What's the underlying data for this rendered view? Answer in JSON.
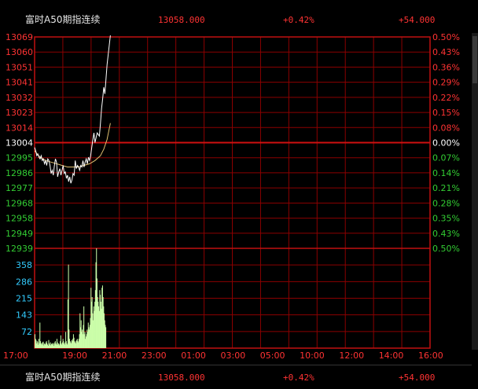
{
  "header": {
    "title": "富时A50期指连续",
    "price": "13058.000",
    "change_pct": "+0.42%",
    "change": "+54.000"
  },
  "footer": {
    "title": "富时A50期指连续",
    "price": "13058.000",
    "change_pct": "+0.42%",
    "change": "+54.000"
  },
  "colors": {
    "background": "#000000",
    "grid": "#8b0000",
    "up": "#ff3333",
    "down": "#33cc33",
    "neutral": "#ffffff",
    "price_line": "#ffffff",
    "avg_line": "#e0c070",
    "volume_axis": "#33ccff",
    "volume_bars": "#ccffaa",
    "time_axis": "#ff3333"
  },
  "chart_data": [
    {
      "type": "line",
      "name": "price",
      "ylim": [
        12939,
        13069
      ],
      "reference": 13004,
      "y_ticks": [
        {
          "label": "13069",
          "pct": "0.50%",
          "dir": "up"
        },
        {
          "label": "13060",
          "pct": "0.43%",
          "dir": "up"
        },
        {
          "label": "13051",
          "pct": "0.36%",
          "dir": "up"
        },
        {
          "label": "13041",
          "pct": "0.29%",
          "dir": "up"
        },
        {
          "label": "13032",
          "pct": "0.22%",
          "dir": "up"
        },
        {
          "label": "13023",
          "pct": "0.15%",
          "dir": "up"
        },
        {
          "label": "13014",
          "pct": "0.08%",
          "dir": "up"
        },
        {
          "label": "13004",
          "pct": "0.00%",
          "dir": "flat"
        },
        {
          "label": "12995",
          "pct": "0.07%",
          "dir": "down"
        },
        {
          "label": "12986",
          "pct": "0.14%",
          "dir": "down"
        },
        {
          "label": "12977",
          "pct": "0.21%",
          "dir": "down"
        },
        {
          "label": "12968",
          "pct": "0.28%",
          "dir": "down"
        },
        {
          "label": "12958",
          "pct": "0.35%",
          "dir": "down"
        },
        {
          "label": "12949",
          "pct": "0.43%",
          "dir": "down"
        },
        {
          "label": "12939",
          "pct": "0.50%",
          "dir": "down"
        }
      ],
      "x_ticks": [
        "17:00",
        "19:00",
        "21:00",
        "23:00",
        "01:00",
        "03:00",
        "05:00",
        "10:00",
        "12:00",
        "14:00",
        "16:00"
      ],
      "session_minutes": 1440,
      "series": [
        {
          "values": [
            [
              0,
              13001
            ],
            [
              4,
              12999
            ],
            [
              8,
              12996
            ],
            [
              12,
              12997
            ],
            [
              16,
              12995
            ],
            [
              20,
              12994
            ],
            [
              24,
              12996
            ],
            [
              28,
              12993
            ],
            [
              32,
              12994
            ],
            [
              36,
              12991
            ],
            [
              40,
              12993
            ],
            [
              44,
              12990
            ],
            [
              48,
              12994
            ],
            [
              52,
              12993
            ],
            [
              56,
              12990
            ],
            [
              60,
              12985
            ],
            [
              64,
              12987
            ],
            [
              68,
              12984
            ],
            [
              72,
              12990
            ],
            [
              76,
              12994
            ],
            [
              80,
              12992
            ],
            [
              84,
              12983
            ],
            [
              88,
              12986
            ],
            [
              92,
              12988
            ],
            [
              96,
              12984
            ],
            [
              100,
              12987
            ],
            [
              104,
              12990
            ],
            [
              108,
              12985
            ],
            [
              112,
              12986
            ],
            [
              116,
              12982
            ],
            [
              120,
              12984
            ],
            [
              124,
              12980
            ],
            [
              128,
              12983
            ],
            [
              132,
              12979
            ],
            [
              136,
              12981
            ],
            [
              140,
              12985
            ],
            [
              144,
              12984
            ],
            [
              148,
              12993
            ],
            [
              152,
              12988
            ],
            [
              156,
              12990
            ],
            [
              160,
              12989
            ],
            [
              164,
              12987
            ],
            [
              168,
              12990
            ],
            [
              172,
              12989
            ],
            [
              176,
              12993
            ],
            [
              180,
              12989
            ],
            [
              184,
              12992
            ],
            [
              188,
              12994
            ],
            [
              192,
              12991
            ],
            [
              196,
              12995
            ],
            [
              200,
              12993
            ],
            [
              204,
              12996
            ],
            [
              208,
              13001
            ],
            [
              212,
              13006
            ],
            [
              216,
              13010
            ],
            [
              220,
              13004
            ],
            [
              224,
              13007
            ],
            [
              228,
              13010
            ],
            [
              232,
              13009
            ],
            [
              236,
              13008
            ],
            [
              240,
              13016
            ],
            [
              244,
              13025
            ],
            [
              248,
              13031
            ],
            [
              252,
              13038
            ],
            [
              256,
              13034
            ],
            [
              260,
              13043
            ],
            [
              264,
              13052
            ],
            [
              268,
              13058
            ],
            [
              272,
              13064
            ],
            [
              276,
              13070
            ]
          ]
        },
        {
          "values": [
            [
              0,
              12999
            ],
            [
              20,
              12995
            ],
            [
              40,
              12993
            ],
            [
              60,
              12992
            ],
            [
              80,
              12991
            ],
            [
              100,
              12990
            ],
            [
              120,
              12989
            ],
            [
              140,
              12989
            ],
            [
              160,
              12989
            ],
            [
              180,
              12990
            ],
            [
              200,
              12991
            ],
            [
              220,
              12993
            ],
            [
              240,
              12996
            ],
            [
              252,
              13000
            ],
            [
              264,
              13006
            ],
            [
              276,
              13016
            ]
          ]
        }
      ]
    },
    {
      "type": "bar",
      "name": "volume",
      "ylim": [
        0,
        430
      ],
      "y_ticks": [
        "358",
        "286",
        "215",
        "143",
        "72"
      ],
      "minute_step": 2,
      "values": [
        60,
        40,
        35,
        20,
        30,
        25,
        15,
        40,
        20,
        110,
        30,
        18,
        22,
        15,
        25,
        28,
        12,
        20,
        15,
        18,
        25,
        30,
        20,
        15,
        10,
        35,
        20,
        15,
        25,
        12,
        18,
        20,
        15,
        22,
        10,
        18,
        25,
        30,
        20,
        15,
        40,
        25,
        15,
        20,
        12,
        18,
        30,
        55,
        20,
        15,
        25,
        40,
        30,
        20,
        15,
        25,
        70,
        30,
        20,
        15,
        210,
        360,
        80,
        40,
        30,
        25,
        20,
        35,
        30,
        40,
        60,
        45,
        30,
        25,
        20,
        30,
        35,
        40,
        30,
        25,
        40,
        60,
        150,
        90,
        120,
        70,
        80,
        60,
        100,
        180,
        60,
        70,
        40,
        50,
        60,
        80,
        70,
        110,
        90,
        80,
        100,
        130,
        260,
        200,
        220,
        150,
        120,
        180,
        160,
        200,
        250,
        370,
        430,
        300,
        220,
        200,
        180,
        160,
        250,
        230,
        200,
        170,
        260,
        270,
        220,
        180,
        150,
        120,
        100,
        90
      ]
    }
  ]
}
